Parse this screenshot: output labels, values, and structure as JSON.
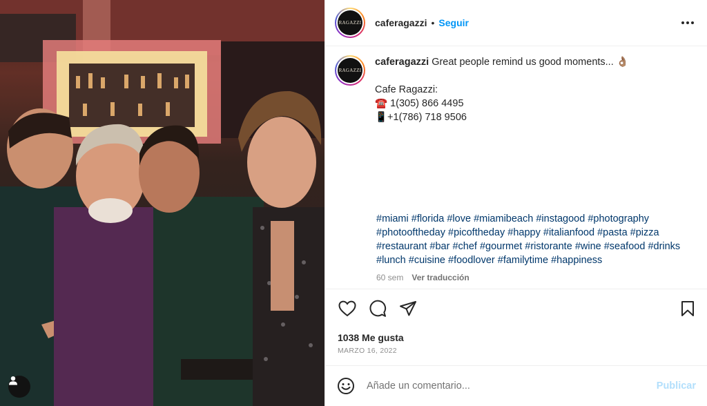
{
  "post": {
    "username": "caferagazzi",
    "follow_label": "Seguir",
    "separator": "•",
    "avatar_text": "RAGAZZI"
  },
  "caption": {
    "username": "caferagazzi",
    "text": "Great people remind us good moments... 👌🏽",
    "lines": [
      "Cafe Ragazzi:",
      "☎️ 1(305) 866 4495",
      "📱+1(786) 718 9506"
    ],
    "hashtags": [
      "#miami",
      "#florida",
      "#love",
      "#miamibeach",
      "#instagood",
      "#photography",
      "#photooftheday",
      "#picoftheday",
      "#happy",
      "#italianfood",
      "#pasta",
      "#pizza",
      "#restaurant",
      "#bar",
      "#chef",
      "#gourmet",
      "#ristorante",
      "#wine",
      "#seafood",
      "#drinks",
      "#lunch",
      "#cuisine",
      "#foodlover",
      "#familytime",
      "#happiness"
    ],
    "age": "60 sem",
    "translate_label": "Ver traducción"
  },
  "stats": {
    "likes": "1038 Me gusta",
    "date": "MARZO 16, 2022"
  },
  "comment": {
    "placeholder": "Añade un comentario...",
    "publish_label": "Publicar"
  },
  "icons": {
    "more": "more-options-icon",
    "like": "heart-icon",
    "comment": "comment-icon",
    "share": "share-icon",
    "save": "bookmark-icon",
    "emoji": "emoji-icon",
    "user_tag": "user-tag-icon"
  },
  "colors": {
    "follow": "#0095f6",
    "hashtag": "#00376b",
    "publish_disabled": "#b2dffc",
    "secondary_text": "#8e8e8e"
  }
}
